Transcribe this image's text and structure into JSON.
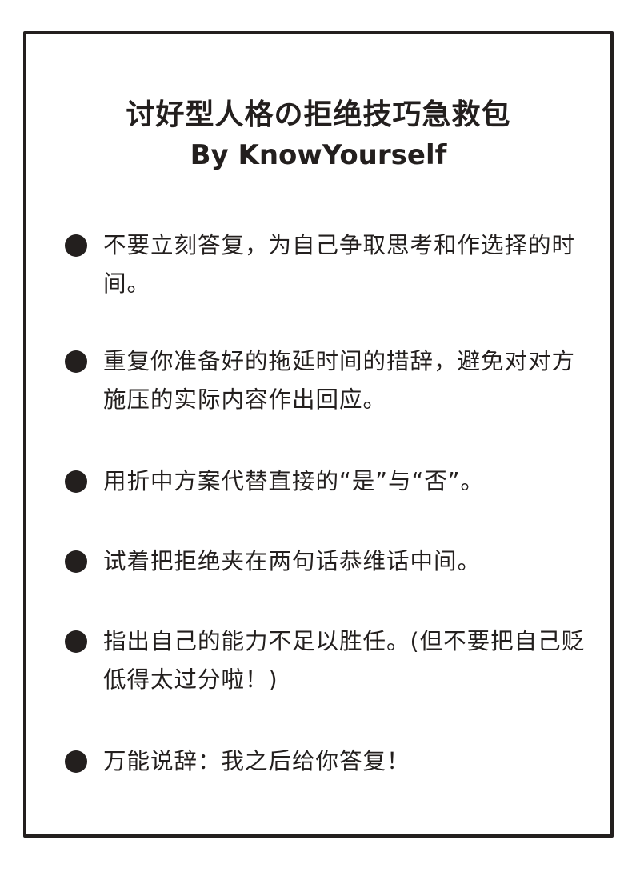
{
  "title": "讨好型人格の拒绝技巧急救包",
  "subtitle": "By KnowYourself",
  "tips": [
    "不要立刻答复，为自己争取思考和作选择的时间。",
    "重复你准备好的拖延时间的措辞，避免对对方施压的实际内容作出回应。",
    "用折中方案代替直接的“是”与“否”。",
    "试着把拒绝夹在两句话恭维话中间。",
    "指出自己的能力不足以胜任。(但不要把自己贬低得太过分啦！)",
    "万能说辞：我之后给你答复！"
  ]
}
